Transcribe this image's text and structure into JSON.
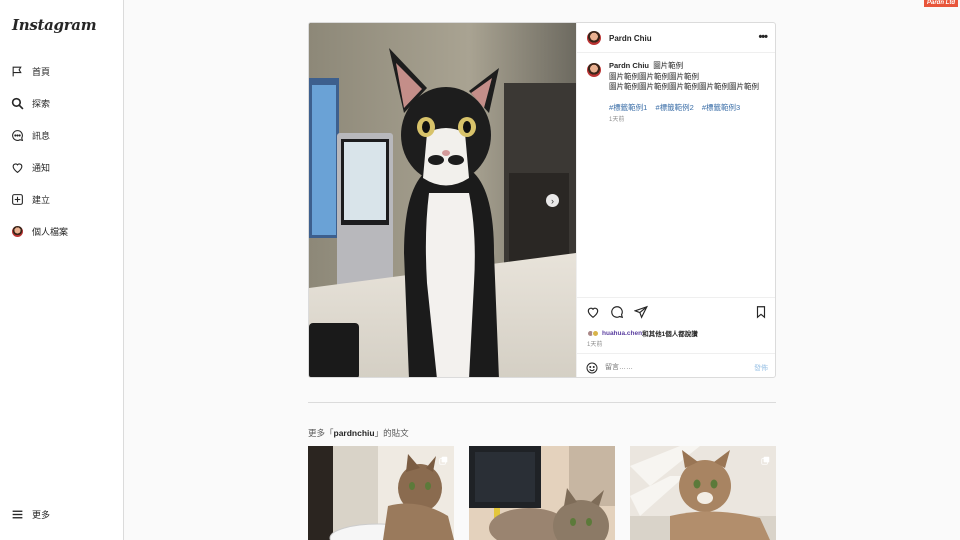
{
  "brand_badge": "Pardn Ltd",
  "sidebar": {
    "logo": "Instagram",
    "items": [
      {
        "label": "首頁",
        "icon": "home-icon"
      },
      {
        "label": "探索",
        "icon": "search-icon"
      },
      {
        "label": "訊息",
        "icon": "messages-icon"
      },
      {
        "label": "通知",
        "icon": "heart-icon"
      },
      {
        "label": "建立",
        "icon": "create-icon"
      },
      {
        "label": "個人檔案",
        "icon": "profile-avatar"
      }
    ],
    "more_label": "更多"
  },
  "post": {
    "author": "Pardn Chiu",
    "caption_author": "Pardn Chiu",
    "caption_line1": "圖片範例",
    "caption_line2": "圖片範例圖片範例圖片範例",
    "caption_line3": "圖片範例圖片範例圖片範例圖片範例圖片範例",
    "tags": [
      "#標籤範例1",
      "#標籤範例2",
      "#標籤範例3"
    ],
    "caption_time": "1天前",
    "liked_by_user": "huahua.chen",
    "liked_by_suffix": "和其他1個人都說讚",
    "post_time": "1天前",
    "comment_placeholder": "留言……",
    "post_button": "發佈",
    "colors": {
      "link": "#3c6fa8",
      "liker": "#5b3fa0",
      "post_button": "#9cc3e6"
    }
  },
  "more_posts": {
    "prefix": "更多「",
    "username": "pardnchiu",
    "suffix": "」的貼文"
  }
}
